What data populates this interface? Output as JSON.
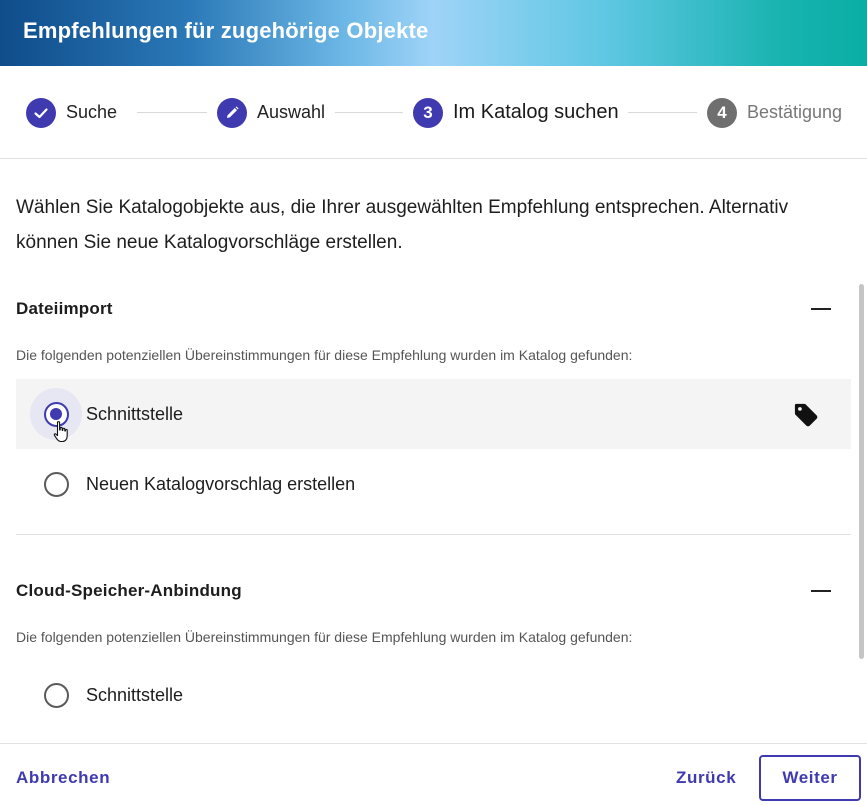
{
  "dialog": {
    "title": "Empfehlungen für zugehörige Objekte"
  },
  "stepper": {
    "steps": [
      {
        "label": "Suche",
        "state": "completed",
        "icon": "check-icon"
      },
      {
        "label": "Auswahl",
        "state": "completed",
        "icon": "pencil-icon"
      },
      {
        "label": "Im Katalog suchen",
        "state": "active",
        "number": "3"
      },
      {
        "label": "Bestätigung",
        "state": "inactive",
        "number": "4"
      }
    ]
  },
  "content": {
    "intro": "Wählen Sie Katalogobjekte aus, die Ihrer ausgewählten Empfehlung entsprechen. Alternativ können Sie neue Katalogvorschläge erstellen.",
    "sections": [
      {
        "title": "Dateiimport",
        "hint": "Die folgenden potenziellen Übereinstimmungen für diese Empfehlung wurden im Katalog gefunden:",
        "options": [
          {
            "label": "Schnittstelle",
            "selected": true,
            "icon": "tag-icon"
          },
          {
            "label": "Neuen Katalogvorschlag erstellen",
            "selected": false
          }
        ]
      },
      {
        "title": "Cloud-Speicher-Anbindung",
        "hint": "Die folgenden potenziellen Übereinstimmungen für diese Empfehlung wurden im Katalog gefunden:",
        "options": [
          {
            "label": "Schnittstelle",
            "selected": false
          }
        ]
      }
    ]
  },
  "footer": {
    "cancel_label": "Abbrechen",
    "back_label": "Zurück",
    "next_label": "Weiter"
  },
  "colors": {
    "accent": "#3f3ab0",
    "inactive_step": "#6f6f6f"
  }
}
